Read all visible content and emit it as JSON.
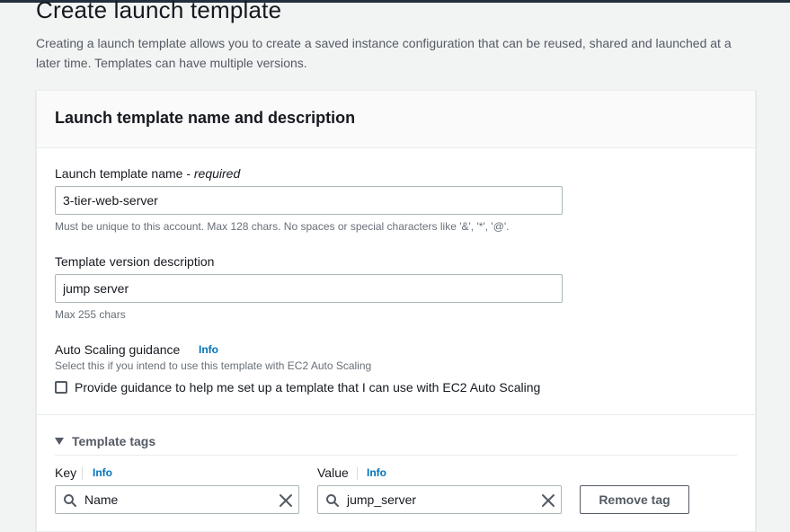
{
  "page": {
    "title": "Create launch template",
    "description": "Creating a launch template allows you to create a saved instance configuration that can be reused, shared and launched at a later time. Templates can have multiple versions."
  },
  "section": {
    "title": "Launch template name and description",
    "name_label": "Launch template name - ",
    "name_required": "required",
    "name_value": "3-tier-web-server",
    "name_hint": "Must be unique to this account. Max 128 chars. No spaces or special characters like '&', '*', '@'.",
    "version_label": "Template version description",
    "version_value": "jump server",
    "version_hint": "Max 255 chars",
    "asg_label": "Auto Scaling guidance",
    "asg_info": "Info",
    "asg_hint": "Select this if you intend to use this template with EC2 Auto Scaling",
    "asg_checkbox_label": "Provide guidance to help me set up a template that I can use with EC2 Auto Scaling",
    "asg_checked": false
  },
  "tags": {
    "title": "Template tags",
    "key_label": "Key",
    "key_info": "Info",
    "value_label": "Value",
    "value_info": "Info",
    "rows": [
      {
        "key": "Name",
        "value": "jump_server"
      }
    ],
    "remove_label": "Remove tag"
  },
  "colors": {
    "accent_link": "#0073bb",
    "text_primary": "#16191f",
    "text_secondary": "#545b64",
    "hint": "#687078",
    "page_bg": "#f2f3f3",
    "header_bar": "#232f3e"
  },
  "icons": {
    "tags_toggle": "caret-down-icon",
    "search": "search-icon",
    "clear": "close-icon"
  }
}
